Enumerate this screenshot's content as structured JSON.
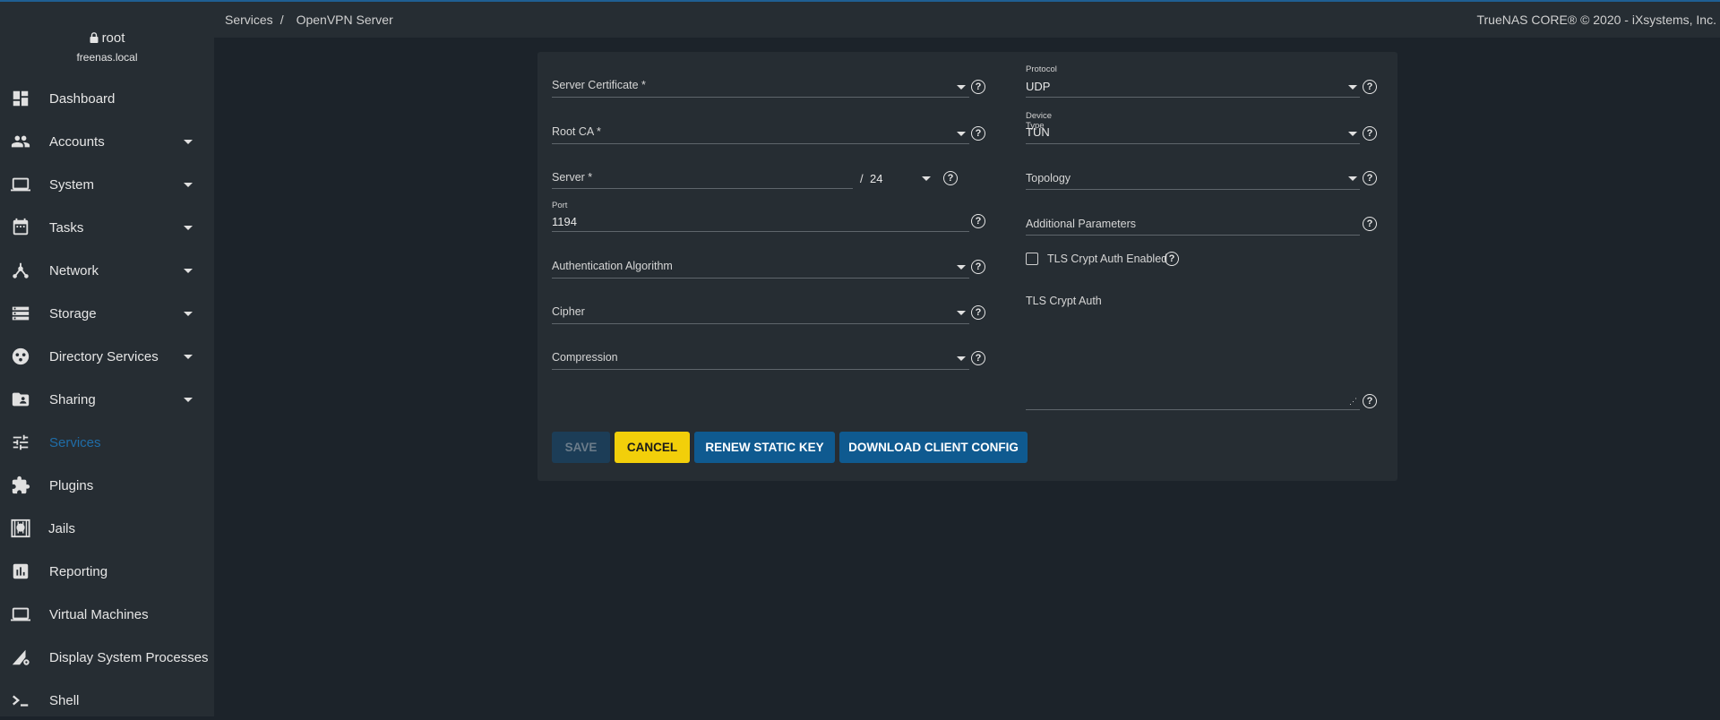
{
  "user": {
    "name": "root",
    "host": "freenas.local"
  },
  "nav": [
    {
      "label": "Dashboard",
      "icon": "dashboard-icon",
      "caret": false
    },
    {
      "label": "Accounts",
      "icon": "people-icon",
      "caret": true
    },
    {
      "label": "System",
      "icon": "laptop-icon",
      "caret": true
    },
    {
      "label": "Tasks",
      "icon": "calendar-icon",
      "caret": true
    },
    {
      "label": "Network",
      "icon": "network-icon",
      "caret": true
    },
    {
      "label": "Storage",
      "icon": "storage-icon",
      "caret": true
    },
    {
      "label": "Directory Services",
      "icon": "directory-icon",
      "caret": true
    },
    {
      "label": "Sharing",
      "icon": "folder-share-icon",
      "caret": true
    },
    {
      "label": "Services",
      "icon": "tune-icon",
      "caret": false,
      "active": true
    },
    {
      "label": "Plugins",
      "icon": "puzzle-icon",
      "caret": false
    },
    {
      "label": "Jails",
      "icon": "jail-icon",
      "caret": false
    },
    {
      "label": "Reporting",
      "icon": "chart-icon",
      "caret": false
    },
    {
      "label": "Virtual Machines",
      "icon": "laptop-icon",
      "caret": false
    },
    {
      "label": "Display System Processes",
      "icon": "processes-icon",
      "caret": false
    },
    {
      "label": "Shell",
      "icon": "terminal-icon",
      "caret": false
    }
  ],
  "header": {
    "breadcrumb_parent": "Services",
    "breadcrumb_sep": "/",
    "breadcrumb_current": "OpenVPN Server",
    "copyright": "TrueNAS CORE® © 2020 - iXsystems, Inc."
  },
  "form": {
    "server_certificate": "Server Certificate *",
    "root_ca": "Root CA *",
    "server": "Server *",
    "server_sep": "/",
    "server_netmask": "24",
    "port_label": "Port",
    "port_value": "1194",
    "auth_algorithm": "Authentication Algorithm",
    "cipher": "Cipher",
    "compression": "Compression",
    "protocol_label": "Protocol",
    "protocol_value": "UDP",
    "device_type_label": "Device Type",
    "device_type_value": "TUN",
    "topology": "Topology",
    "additional_parameters": "Additional Parameters",
    "tls_crypt_auth_enabled": "TLS Crypt Auth Enabled",
    "tls_crypt_auth": "TLS Crypt Auth",
    "help_glyph": "?",
    "resize_glyph": "⋰"
  },
  "buttons": {
    "save": "SAVE",
    "cancel": "CANCEL",
    "renew": "RENEW STATIC KEY",
    "download": "DOWNLOAD CLIENT CONFIG"
  },
  "colors": {
    "accent": "#0f5a90",
    "cancel": "#f2cf0a",
    "active_nav": "#1f6da8",
    "background": "#1c232a",
    "panel": "#262d33"
  }
}
